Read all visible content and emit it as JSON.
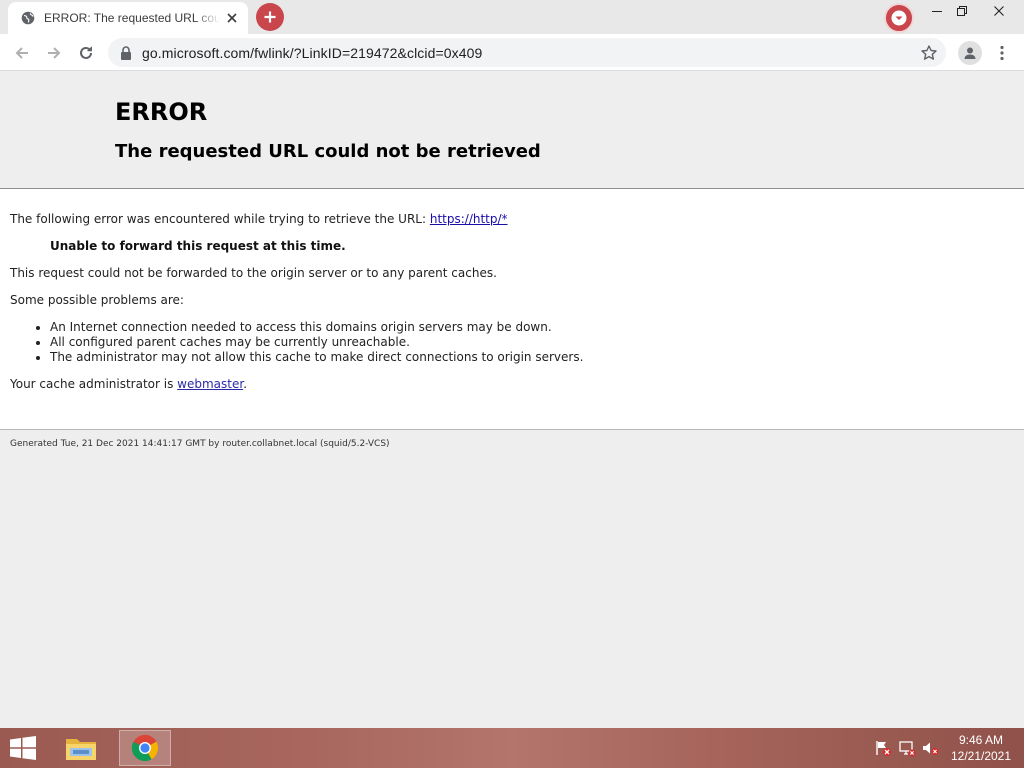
{
  "browser": {
    "tab": {
      "title": "ERROR: The requested URL could not be retrieved",
      "favicon": "globe-icon"
    },
    "new_tab_icon": "plus-icon",
    "profile_icon": "chevron-down-icon",
    "url": "go.microsoft.com/fwlink/?LinkID=219472&clcid=0x409",
    "accent_color": "#c8464c"
  },
  "page": {
    "heading": "ERROR",
    "subheading": "The requested URL could not be retrieved",
    "intro_text": "The following error was encountered while trying to retrieve the URL: ",
    "intro_link": "https://http/*",
    "error_detail": "Unable to forward this request at this time.",
    "forward_text": "This request could not be forwarded to the origin server or to any parent caches.",
    "problems_intro": "Some possible problems are:",
    "problems": [
      "An Internet connection needed to access this domains origin servers may be down.",
      "All configured parent caches may be currently unreachable.",
      "The administrator may not allow this cache to make direct connections to origin servers."
    ],
    "admin_text": "Your cache administrator is ",
    "admin_link": "webmaster",
    "admin_suffix": ".",
    "footer": "Generated Tue, 21 Dec 2021 14:41:17 GMT by router.collabnet.local (squid/5.2-VCS)"
  },
  "taskbar": {
    "apps": [
      "file-explorer-icon",
      "chrome-icon"
    ],
    "tray_icons": [
      "action-center-flag-icon",
      "network-icon",
      "volume-muted-icon"
    ],
    "time": "9:46 AM",
    "date": "12/21/2021",
    "colors": {
      "bar": "#a8665e"
    }
  }
}
